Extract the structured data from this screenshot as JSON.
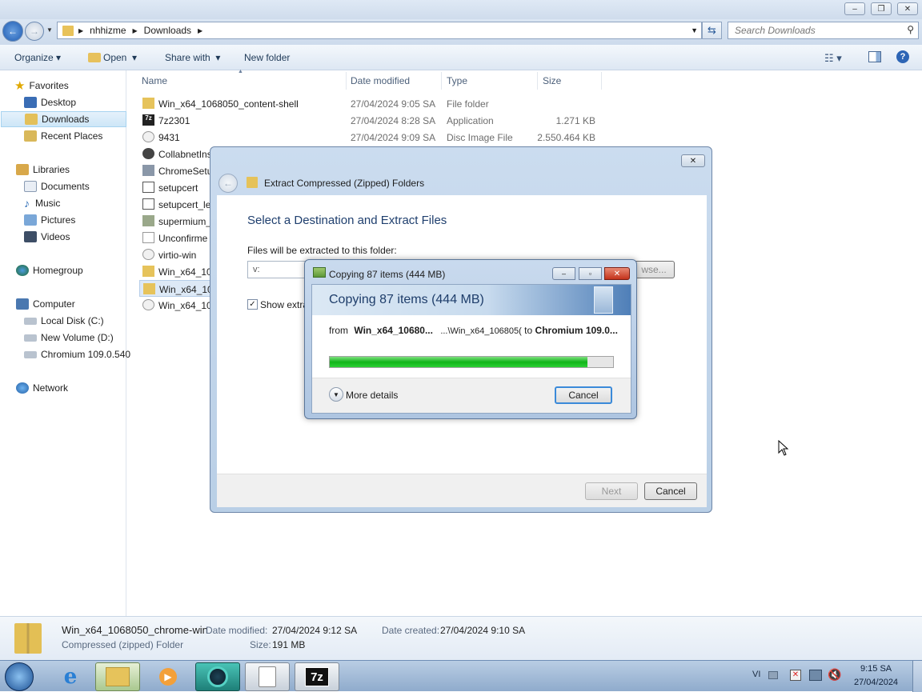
{
  "explorer": {
    "breadcrumb": [
      "nhhizme",
      "Downloads"
    ],
    "search_placeholder": "Search Downloads",
    "toolbar": {
      "organize": "Organize",
      "open": "Open",
      "share_with": "Share with",
      "new_folder": "New folder"
    },
    "nav": {
      "favorites": "Favorites",
      "desktop": "Desktop",
      "downloads": "Downloads",
      "recent_places": "Recent Places",
      "libraries": "Libraries",
      "documents": "Documents",
      "music": "Music",
      "pictures": "Pictures",
      "videos": "Videos",
      "homegroup": "Homegroup",
      "computer": "Computer",
      "local_disk": "Local Disk (C:)",
      "new_volume": "New Volume (D:)",
      "chromium": "Chromium 109.0.540",
      "network": "Network"
    },
    "columns": {
      "name": "Name",
      "date": "Date modified",
      "type": "Type",
      "size": "Size"
    },
    "files": [
      {
        "name": "Win_x64_1068050_content-shell",
        "date": "27/04/2024 9:05 SA",
        "type": "File folder",
        "size": ""
      },
      {
        "name": "7z2301",
        "date": "27/04/2024 8:28 SA",
        "type": "Application",
        "size": "1.271 KB"
      },
      {
        "name": "9431",
        "date": "27/04/2024 9:09 SA",
        "type": "Disc Image File",
        "size": "2.550.464 KB"
      },
      {
        "name": "CollabnetIns",
        "date": "",
        "type": "",
        "size": ""
      },
      {
        "name": "ChromeSetu",
        "date": "",
        "type": "",
        "size": ""
      },
      {
        "name": "setupcert",
        "date": "",
        "type": "",
        "size": ""
      },
      {
        "name": "setupcert_le",
        "date": "",
        "type": "",
        "size": ""
      },
      {
        "name": "supermium_",
        "date": "",
        "type": "",
        "size": ""
      },
      {
        "name": "Unconfirme",
        "date": "",
        "type": "",
        "size": ""
      },
      {
        "name": "virtio-win",
        "date": "",
        "type": "",
        "size": ""
      },
      {
        "name": "Win_x64_106",
        "date": "",
        "type": "",
        "size": ""
      },
      {
        "name": "Win_x64_106",
        "date": "",
        "type": "",
        "size": ""
      },
      {
        "name": "Win_x64_106",
        "date": "",
        "type": "",
        "size": ""
      }
    ],
    "details": {
      "name": "Win_x64_1068050_chrome-win",
      "kind": "Compressed (zipped) Folder",
      "date_modified_label": "Date modified:",
      "date_modified": "27/04/2024 9:12 SA",
      "date_created_label": "Date created:",
      "date_created": "27/04/2024 9:10 SA",
      "size_label": "Size:",
      "size": "191 MB"
    }
  },
  "extract_dialog": {
    "title": "Extract Compressed (Zipped) Folders",
    "heading": "Select a Destination and Extract Files",
    "folder_label": "Files will be extracted to this folder:",
    "folder_value": "v:",
    "browse": "wse...",
    "show_label": "Show extra",
    "next": "Next",
    "cancel": "Cancel"
  },
  "copy_dialog": {
    "title": "Copying 87 items (444 MB)",
    "heading": "Copying 87 items (444 MB)",
    "from_label": "from",
    "from_src": "Win_x64_10680...",
    "from_path": "...\\Win_x64_106805(",
    "to_label": "to",
    "to_dest": "Chromium 109.0...",
    "progress": 0.91,
    "more_details": "More details",
    "cancel": "Cancel"
  },
  "taskbar": {
    "lang": "VI",
    "time": "9:15 SA",
    "date": "27/04/2024"
  }
}
